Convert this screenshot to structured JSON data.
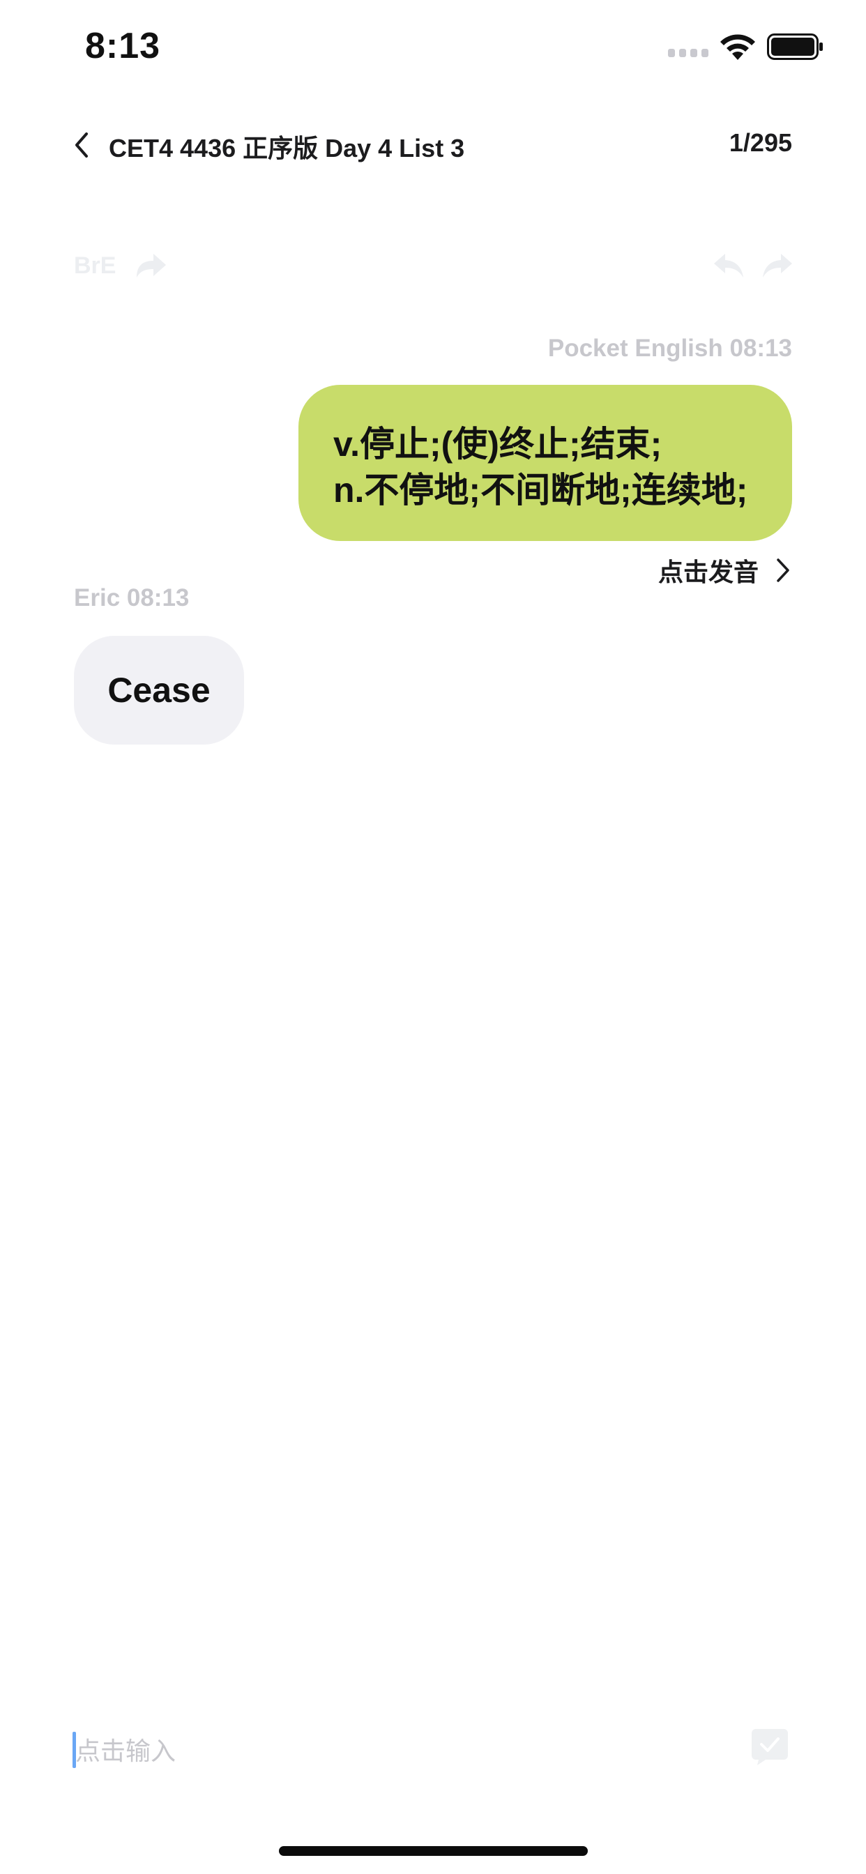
{
  "status_bar": {
    "time": "8:13"
  },
  "nav": {
    "title": "CET4 4436 正序版 Day 4 List 3",
    "progress": "1/295"
  },
  "toolbar": {
    "accent_label": "BrE"
  },
  "messages": [
    {
      "sender": "Pocket English",
      "time": "08:13",
      "meta": "Pocket English 08:13",
      "lines": [
        "v.停止;(使)终止;结束;",
        "n.不停地;不间断地;连续地;"
      ],
      "action_label": "点击发音"
    },
    {
      "sender": "Eric",
      "time": "08:13",
      "meta": "Eric 08:13",
      "text": "Cease"
    }
  ],
  "composer": {
    "placeholder": "点击输入"
  },
  "colors": {
    "bubble_green": "#c8dc6a",
    "bubble_gray": "#f1f1f5",
    "meta_text": "#c7c7cc",
    "caret": "#6aa7f5"
  },
  "icons": [
    "back-chevron-icon",
    "share-icon",
    "undo-icon",
    "redo-icon",
    "chevron-right-icon",
    "send-check-icon",
    "wifi-icon",
    "battery-icon"
  ]
}
